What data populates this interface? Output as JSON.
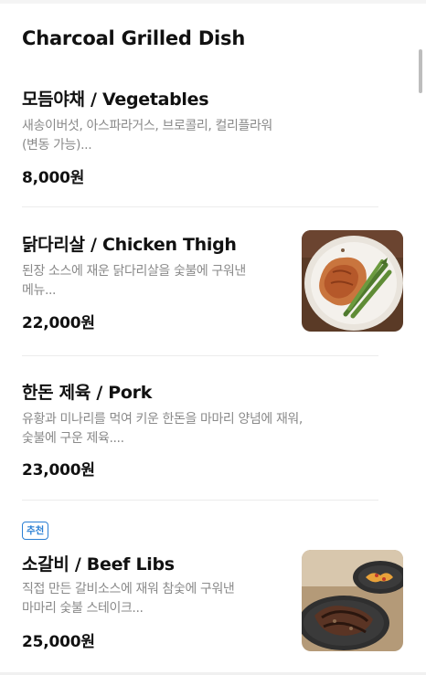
{
  "section": {
    "title": "Charcoal Grilled Dish"
  },
  "items": [
    {
      "name": "모듬야채 / Vegetables",
      "desc_line1": "새송이버섯, 아스파라거스, 브로콜리, 컬리플라워",
      "desc_line2": "(변동 가능)...",
      "price": "8,000원"
    },
    {
      "name": "닭다리살 / Chicken Thigh",
      "desc_line1": "된장 소스에 재운 닭다리살을 숯불에 구워낸",
      "desc_line2": "메뉴...",
      "price": "22,000원",
      "image": "grilled-chicken-with-asparagus-photo"
    },
    {
      "name": "한돈 제육 / Pork",
      "desc_line1": "유황과 미나리를 먹여 키운 한돈을 마마리 양념에 재워,",
      "desc_line2": "숯불에 구운 제육....",
      "price": "23,000원"
    },
    {
      "badge": "추천",
      "name": "소갈비 / Beef Libs",
      "desc_line1": "직접 만든 갈비소스에 재워 참숯에 구워낸",
      "desc_line2": "마마리 숯불 스테이크...",
      "price": "25,000원",
      "image": "grilled-beef-ribs-photo"
    }
  ],
  "colors": {
    "badge": "#2a7fd4",
    "description": "#8a8a8a",
    "divider": "#ececec"
  }
}
